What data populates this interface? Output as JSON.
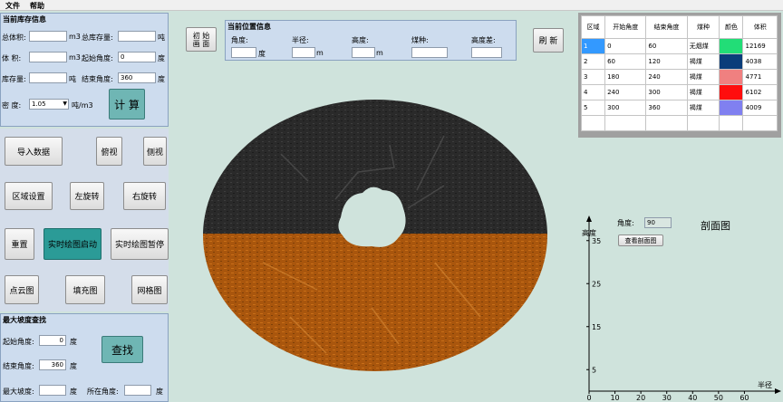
{
  "menu": {
    "file": "文件",
    "help": "帮助"
  },
  "storage": {
    "title": "当前库存信息",
    "total_volume_label": "总体积:",
    "total_volume_value": "",
    "total_volume_unit": "m3",
    "total_stock_label": "总库存量:",
    "total_stock_value": "",
    "total_stock_unit": "吨",
    "volume_label": "体 积:",
    "volume_value": "",
    "volume_unit": "m3",
    "start_angle_label": "起始角度:",
    "start_angle_value": "0",
    "start_angle_unit": "度",
    "stock_label": "库存量:",
    "stock_value": "",
    "stock_unit": "吨",
    "end_angle_label": "结束角度:",
    "end_angle_value": "360",
    "end_angle_unit": "度",
    "density_label": "密 度:",
    "density_value": "1.05",
    "density_unit": "吨/m3",
    "calc_button": "计 算"
  },
  "buttons": {
    "import": "导入数据",
    "top_view": "俯视",
    "side_view": "侧视",
    "region": "区域设置",
    "rotate_left": "左旋转",
    "rotate_right": "右旋转",
    "reset": "重置",
    "realtime_start": "实时绘图启动",
    "realtime_pause": "实时绘图暂停",
    "point_cloud": "点云图",
    "fill": "填充图",
    "mesh": "网格图",
    "init": "初 始 画 面",
    "refresh": "刷 新"
  },
  "slope": {
    "title": "最大坡度查找",
    "start_label": "起始角度:",
    "start_value": "0",
    "start_unit": "度",
    "end_label": "结束角度:",
    "end_value": "360",
    "end_unit": "度",
    "max_slope_label": "最大坡度:",
    "max_slope_value": "",
    "max_slope_unit": "度",
    "at_angle_label": "所在角度:",
    "at_angle_value": "",
    "at_angle_unit": "度",
    "find_button": "查找"
  },
  "position": {
    "title": "当前位置信息",
    "angle_label": "角度:",
    "angle_value": "",
    "angle_unit": "度",
    "radius_label": "半径:",
    "radius_value": "",
    "radius_unit": "m",
    "height_label": "高度:",
    "height_value": "",
    "height_unit": "m",
    "coal_label": "煤种:",
    "coal_value": "",
    "height_diff_label": "高度差:",
    "height_diff_value": ""
  },
  "region_table": {
    "headers": [
      "区域",
      "开始角度",
      "结束角度",
      "煤种",
      "颜色",
      "体积"
    ],
    "rows": [
      {
        "id": "1",
        "start": "0",
        "end": "60",
        "coal": "无烟煤",
        "color": "#22dd77",
        "volume": "12169"
      },
      {
        "id": "2",
        "start": "60",
        "end": "120",
        "coal": "褐煤",
        "color": "#0a3d7a",
        "volume": "4038"
      },
      {
        "id": "3",
        "start": "180",
        "end": "240",
        "coal": "褐煤",
        "color": "#f08080",
        "volume": "4771"
      },
      {
        "id": "4",
        "start": "240",
        "end": "300",
        "coal": "褐煤",
        "color": "#ff0d0d",
        "volume": "6102"
      },
      {
        "id": "5",
        "start": "300",
        "end": "360",
        "coal": "褐煤",
        "color": "#8080f0",
        "volume": "4009"
      }
    ]
  },
  "profile": {
    "title": "剖面图",
    "angle_label": "角度:",
    "angle_value": "90",
    "view_button": "查看剖面图",
    "ylabel": "高度",
    "xlabel": "半径"
  },
  "chart_data": {
    "type": "line",
    "title": "剖面图",
    "xlabel": "半径",
    "ylabel": "高度",
    "xticks": [
      0,
      10,
      20,
      30,
      40,
      50,
      60
    ],
    "yticks": [
      5,
      15,
      25,
      35
    ],
    "xlim": [
      0,
      70
    ],
    "ylim": [
      0,
      40
    ],
    "series": []
  },
  "colors": {
    "panel": "#cddcee",
    "background": "#cfe3dc",
    "teal_button": "#2b9b97",
    "coal_dark": "#2a2a2a",
    "coal_orange": "#b05a0e"
  }
}
